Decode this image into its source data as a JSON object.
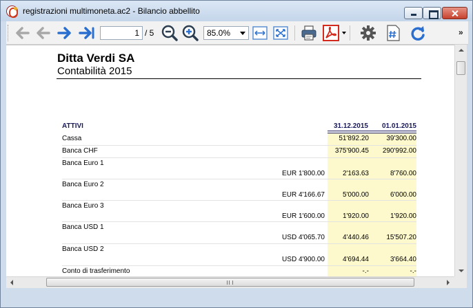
{
  "window": {
    "title": "registrazioni multimoneta.ac2 - Bilancio abbellito"
  },
  "toolbar": {
    "page_current": "1",
    "page_total": "/ 5",
    "zoom": "85.0%",
    "overflow": "»",
    "icons": [
      "back-icon",
      "forward-disabled-icon",
      "forward-icon",
      "last-page-icon",
      "zoom-out-icon",
      "zoom-in-icon",
      "fit-width-icon",
      "fit-page-icon",
      "print-icon",
      "pdf-icon",
      "settings-icon",
      "page-number-icon",
      "refresh-icon"
    ]
  },
  "report": {
    "company": "Ditta Verdi SA",
    "subtitle": "Contabilità 2015",
    "section_label": "ATTIVI",
    "col1_header": "31.12.2015",
    "col2_header": "01.01.2015",
    "rows": [
      {
        "label": "Cassa",
        "currency": "",
        "v1": "51'892.20",
        "v2": "39'300.00"
      },
      {
        "label": "Banca CHF",
        "currency": "",
        "v1": "375'900.45",
        "v2": "290'992.00"
      },
      {
        "label": "Banca Euro 1",
        "currency": "EUR 1'800.00",
        "v1": "2'163.63",
        "v2": "8'760.00"
      },
      {
        "label": "Banca Euro 2",
        "currency": "EUR 4'166.67",
        "v1": "5'000.00",
        "v2": "6'000.00"
      },
      {
        "label": "Banca Euro 3",
        "currency": "EUR 1'600.00",
        "v1": "1'920.00",
        "v2": "1'920.00"
      },
      {
        "label": "Banca USD 1",
        "currency": "USD 4'065.70",
        "v1": "4'440.46",
        "v2": "15'507.20"
      },
      {
        "label": "Banca USD 2",
        "currency": "USD 4'900.00",
        "v1": "4'694.44",
        "v2": "3'664.40"
      },
      {
        "label": "Conto di trasferimento",
        "currency": "",
        "v1": "-.-",
        "v2": "-.-"
      }
    ]
  },
  "colors": {
    "accent_blue": "#2a6fd0",
    "pdf_red": "#d42a1d",
    "highlight": "#fdf9cc"
  }
}
